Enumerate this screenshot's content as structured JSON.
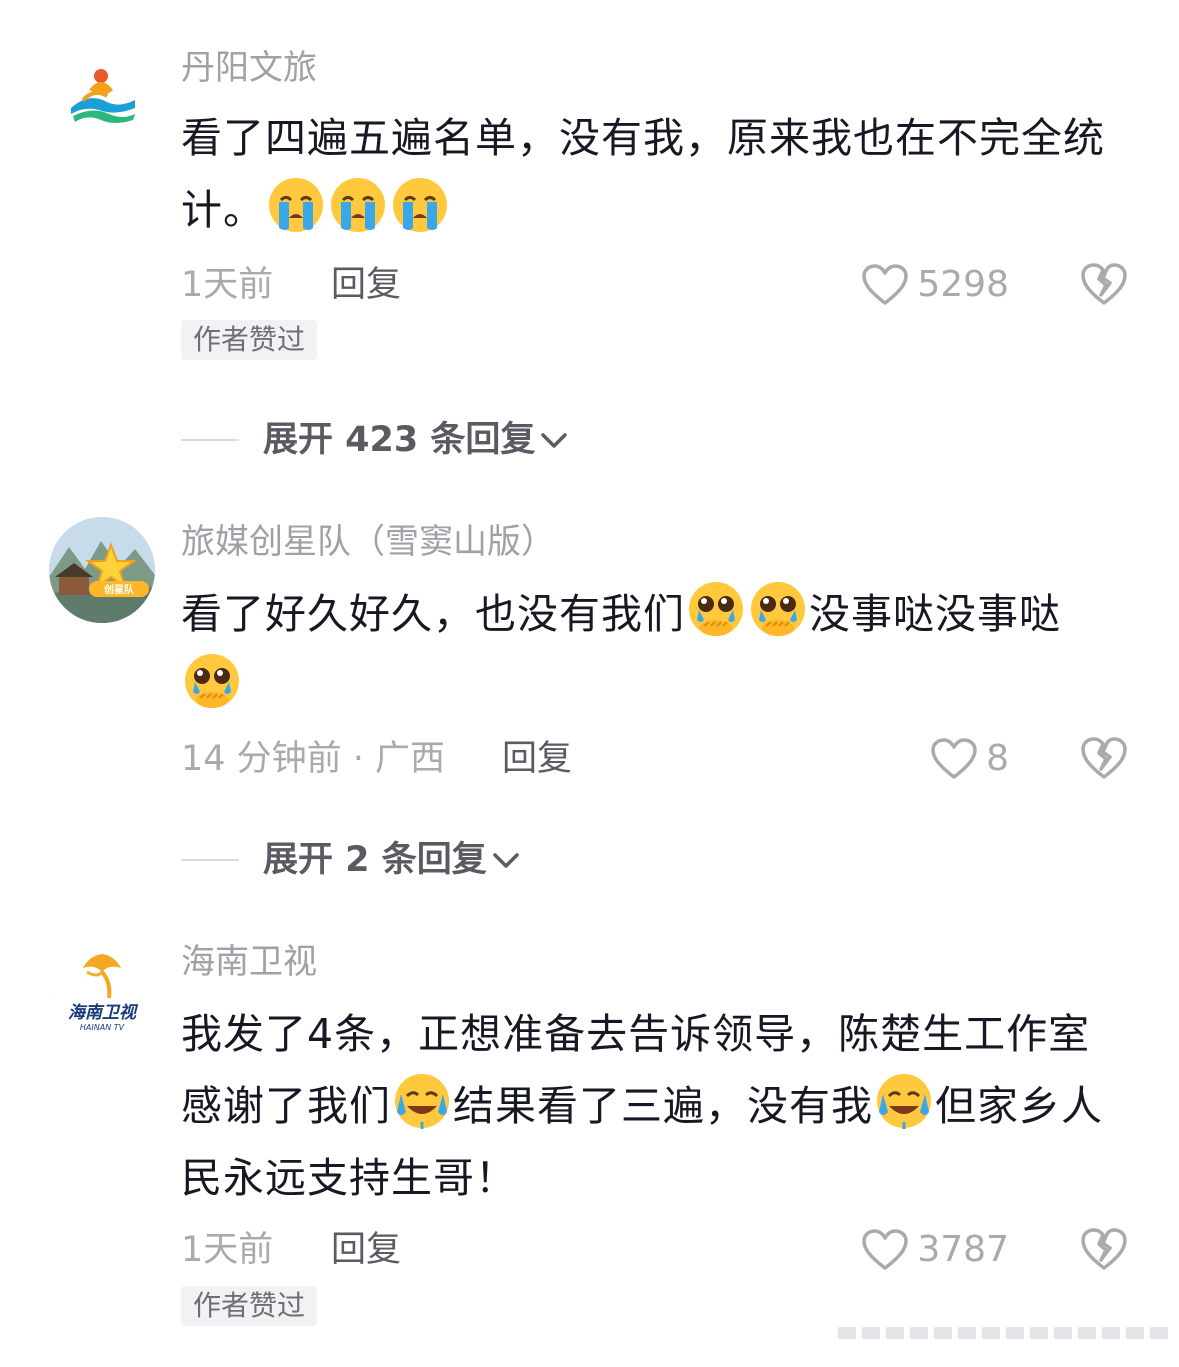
{
  "comments": [
    {
      "username": "丹阳文旅",
      "text_parts": [
        "看了四遍五遍名单，没有我，原来我也在不完全统计。"
      ],
      "emoji_trailing": [
        "crying-face",
        "crying-face",
        "crying-face"
      ],
      "time": "1天前",
      "reply_label": "回复",
      "likes": "5298",
      "badge": "作者赞过",
      "expand_label": "展开 423 条回复"
    },
    {
      "username": "旅媒创星队（雪窦山版）",
      "avatar_text": "创星队",
      "text_a": "看了好久好久，也没有我们",
      "text_b": "没事哒没事哒",
      "time": "14 分钟前 · 广西",
      "reply_label": "回复",
      "likes": "8",
      "expand_label": "展开 2 条回复"
    },
    {
      "username": "海南卫视",
      "avatar_text": "海南卫视",
      "avatar_subtext": "HAINAN TV",
      "text_a": "我发了4条，正想准备去告诉领导，陈楚生工作室感谢了我们",
      "text_b": "结果看了三遍，没有我",
      "text_c": "但家乡人民永远支持生哥！",
      "time": "1天前",
      "reply_label": "回复",
      "likes": "3787",
      "badge": "作者赞过"
    }
  ],
  "icons": {
    "like": "heart-outline-icon",
    "dislike": "broken-heart-icon",
    "expand": "chevron-down-icon"
  },
  "colors": {
    "text": "#161823",
    "secondary": "#a9a9ae",
    "badge_bg": "#f2f2f4"
  }
}
